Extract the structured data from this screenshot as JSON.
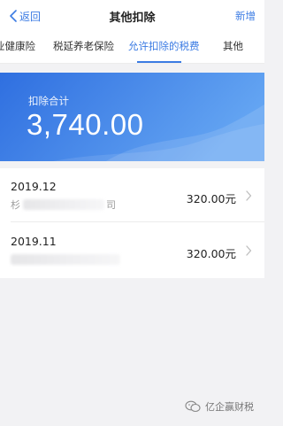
{
  "header": {
    "back_label": "返回",
    "title": "其他扣除",
    "new_label": "新增"
  },
  "tabs": [
    {
      "label": "业健康险",
      "active": false
    },
    {
      "label": "税延养老保险",
      "active": false
    },
    {
      "label": "允许扣除的税费",
      "active": true
    },
    {
      "label": "其他",
      "active": false
    }
  ],
  "summary": {
    "label": "扣除合计",
    "amount": "3,740.00"
  },
  "records": [
    {
      "date": "2019.12",
      "sub_visible": "杉",
      "sub_tail": "司",
      "amount": "320.00元"
    },
    {
      "date": "2019.11",
      "amount": "320.00元"
    }
  ],
  "watermark": {
    "text": "亿企赢财税"
  },
  "colors": {
    "accent": "#3b7be3",
    "banner_left": "#2f6fe0",
    "banner_right": "#63a4f2"
  }
}
